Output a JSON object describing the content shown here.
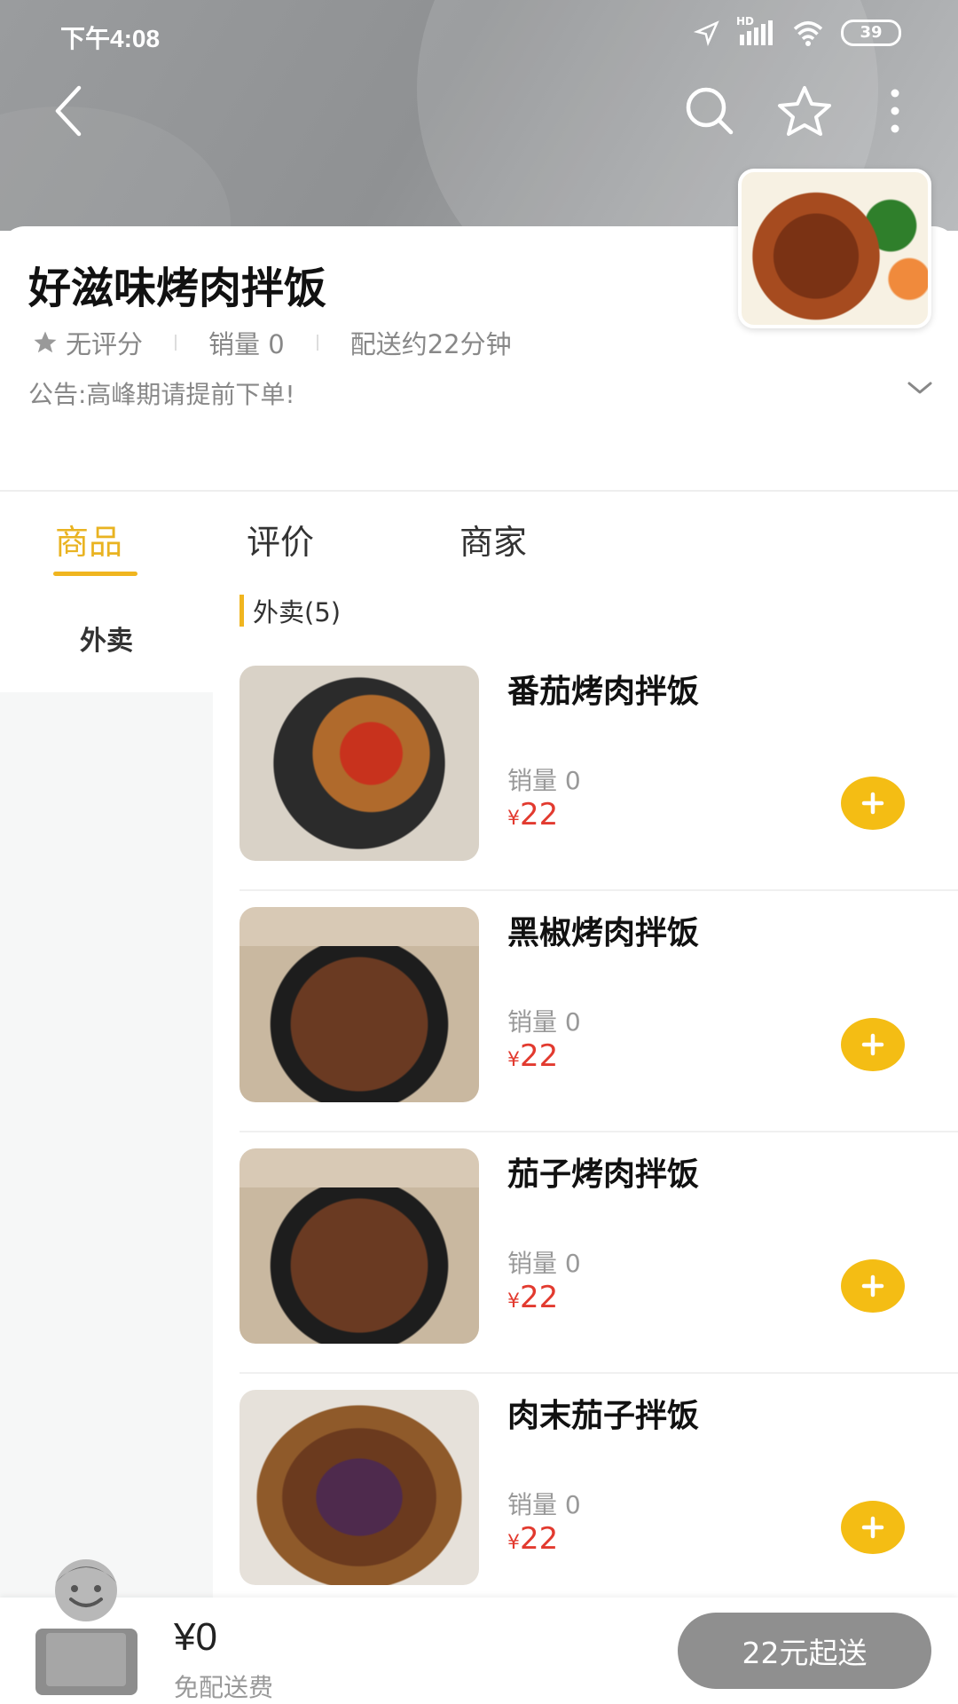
{
  "status_bar": {
    "time": "下午4:08",
    "network": "HD",
    "battery": "39",
    "icons": [
      "location-arrow-icon",
      "signal-icon",
      "wifi-icon",
      "battery-icon"
    ]
  },
  "topbar": {
    "icons": [
      "back-icon",
      "search-icon",
      "star-icon",
      "more-vertical-icon"
    ]
  },
  "shop": {
    "name": "好滋味烤肉拌饭",
    "rating": "无评分",
    "sales": "销量 0",
    "delivery": "配送约22分钟",
    "notice": "公告:高峰期请提前下单!"
  },
  "tabs": [
    {
      "label": "商品",
      "active": true
    },
    {
      "label": "评价",
      "active": false
    },
    {
      "label": "商家",
      "active": false
    }
  ],
  "categories": [
    {
      "label": "外卖",
      "active": true
    }
  ],
  "section": {
    "title": "外卖(5)"
  },
  "products": [
    {
      "name": "番茄烤肉拌饭",
      "sales": "销量 0",
      "currency": "¥",
      "price": "22"
    },
    {
      "name": "黑椒烤肉拌饭",
      "sales": "销量 0",
      "currency": "¥",
      "price": "22"
    },
    {
      "name": "茄子烤肉拌饭",
      "sales": "销量 0",
      "currency": "¥",
      "price": "22"
    },
    {
      "name": "肉末茄子拌饭",
      "sales": "销量 0",
      "currency": "¥",
      "price": "22"
    }
  ],
  "cart": {
    "amount": "¥0",
    "fee": "免配送费",
    "min_button": "22元起送"
  },
  "colors": {
    "accent": "#f0b51f",
    "price": "#e23a2f",
    "disabled_button": "#8f8f8f"
  }
}
